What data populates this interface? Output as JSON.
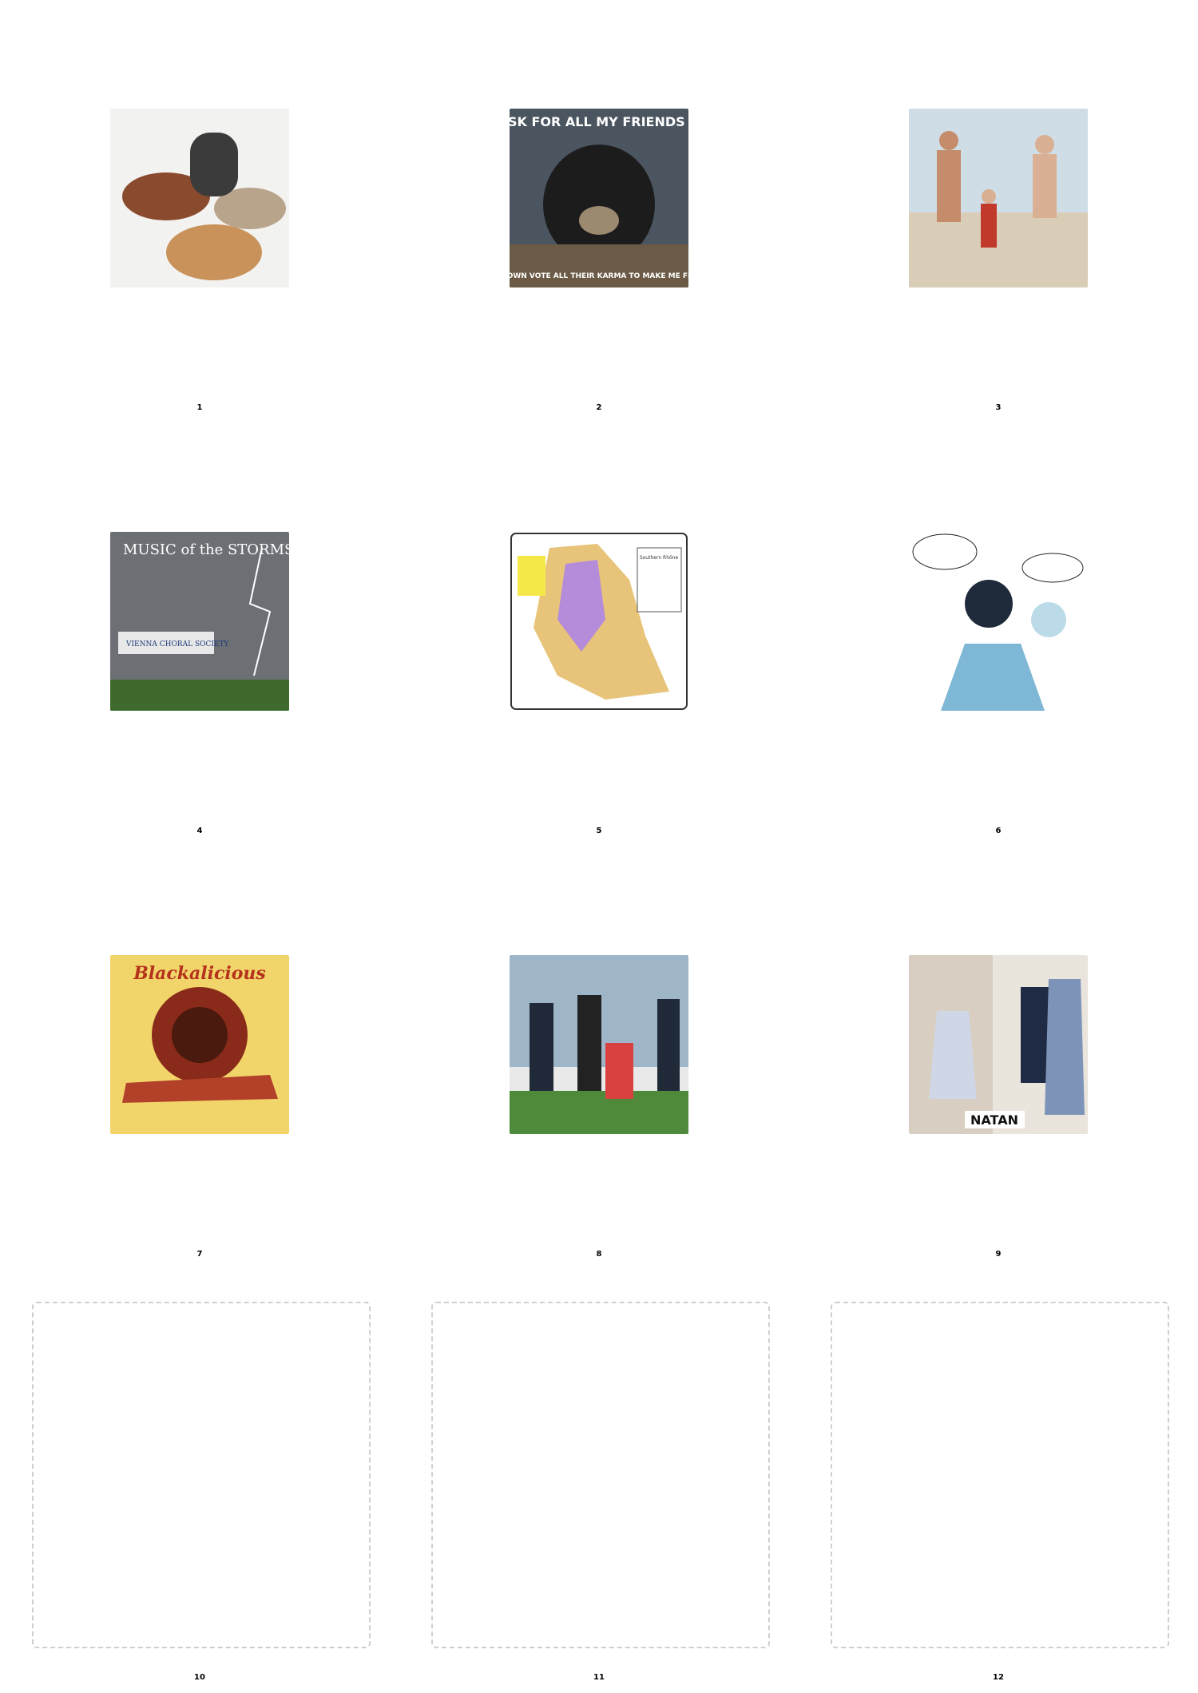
{
  "tiles": [
    {
      "index": "1",
      "icon": "pottery-photo-icon"
    },
    {
      "index": "2",
      "icon": "bear-meme-photo-icon",
      "caption_top": "I ASK FOR ALL MY FRIENDS /U/",
      "caption_bottom": "SO I CAN DOWN VOTE ALL THEIR KARMA TO MAKE ME FEEL BETTER"
    },
    {
      "index": "3",
      "icon": "beach-family-photo-icon"
    },
    {
      "index": "4",
      "icon": "concert-poster-icon",
      "title": "MUSIC of the STORMS",
      "org": "VIENNA CHORAL SOCIETY"
    },
    {
      "index": "5",
      "icon": "wine-region-map-icon",
      "title": "Southern Rhône"
    },
    {
      "index": "6",
      "icon": "comic-panel-icon"
    },
    {
      "index": "7",
      "icon": "album-cover-icon",
      "title": "Blackalicious"
    },
    {
      "index": "8",
      "icon": "football-match-photo-icon"
    },
    {
      "index": "9",
      "icon": "fashion-photo-icon",
      "label": "NATAN"
    },
    {
      "index": "10"
    },
    {
      "index": "11"
    },
    {
      "index": "12"
    }
  ]
}
